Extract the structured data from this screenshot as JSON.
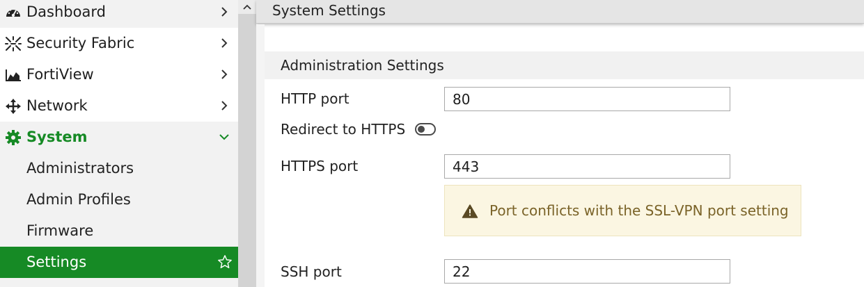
{
  "colors": {
    "accent": "#168a25",
    "sidebar_bg": "#f5f5f5",
    "warning_bg": "#fbf6e2",
    "warning_text": "#7a6328"
  },
  "sidebar": {
    "items": [
      {
        "label": "Dashboard",
        "icon": "dashboard-gauge-icon",
        "chevron": "chevron-right-icon"
      },
      {
        "label": "Security Fabric",
        "icon": "security-fabric-icon",
        "chevron": "chevron-right-icon"
      },
      {
        "label": "FortiView",
        "icon": "area-chart-icon",
        "chevron": "chevron-right-icon"
      },
      {
        "label": "Network",
        "icon": "arrows-move-icon",
        "chevron": "chevron-right-icon"
      },
      {
        "label": "System",
        "icon": "gear-icon",
        "chevron": "chevron-down-icon",
        "expanded": true
      },
      {
        "label": "Administrators"
      },
      {
        "label": "Admin Profiles"
      },
      {
        "label": "Firmware"
      },
      {
        "label": "Settings",
        "active": true,
        "icon": "star-outline-icon"
      }
    ]
  },
  "header": {
    "title": "System Settings"
  },
  "section": {
    "title": "Administration Settings"
  },
  "form": {
    "http_port": {
      "label": "HTTP port",
      "value": "80"
    },
    "redirect": {
      "label": "Redirect to HTTPS",
      "enabled": false
    },
    "https_port": {
      "label": "HTTPS port",
      "value": "443"
    },
    "warning": {
      "text": "Port conflicts with the SSL-VPN port setting",
      "icon": "warning-triangle-icon"
    },
    "ssh_port": {
      "label": "SSH port",
      "value": "22"
    }
  }
}
